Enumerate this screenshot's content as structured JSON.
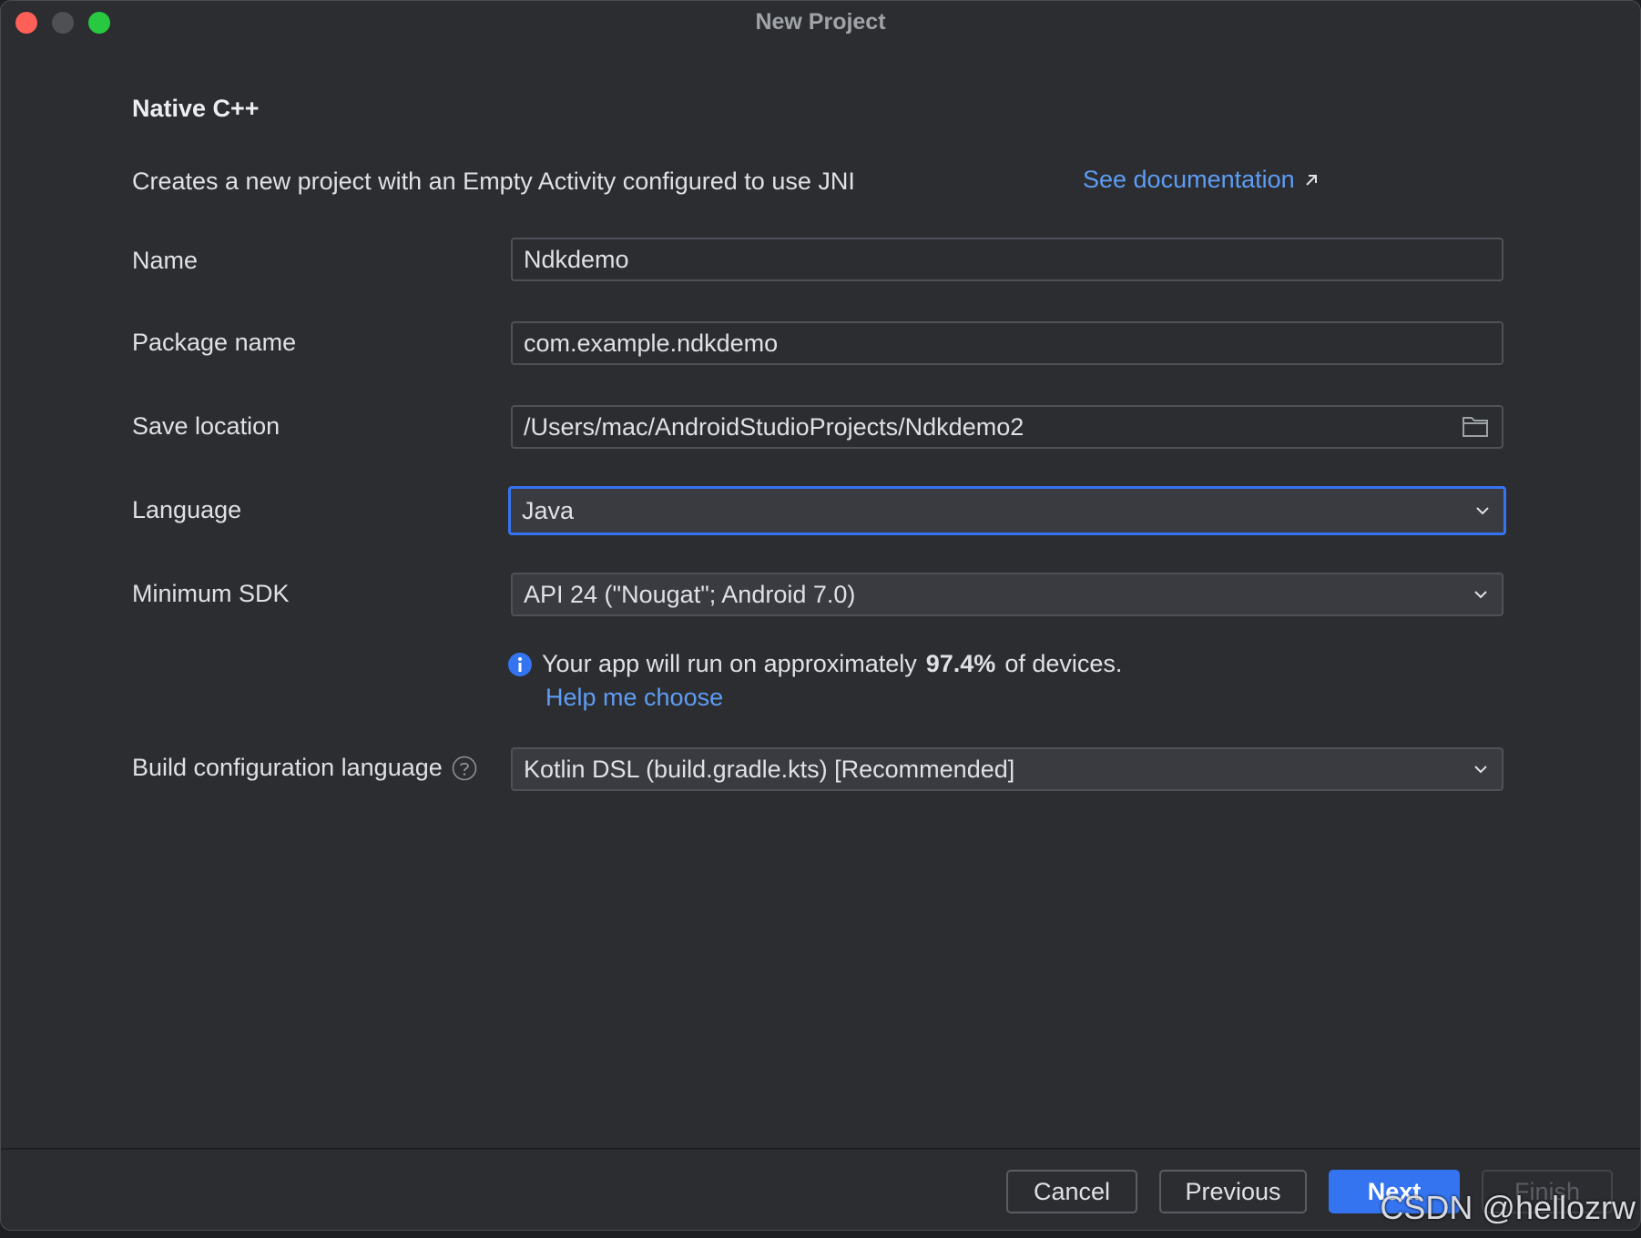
{
  "window": {
    "title": "New Project"
  },
  "template": {
    "name": "Native C++",
    "description": "Creates a new project with an Empty Activity configured to use JNI",
    "doc_link": "See documentation"
  },
  "form": {
    "name": {
      "label": "Name",
      "value": "Ndkdemo"
    },
    "package": {
      "label": "Package name",
      "value": "com.example.ndkdemo"
    },
    "location": {
      "label": "Save location",
      "value": "/Users/mac/AndroidStudioProjects/Ndkdemo2"
    },
    "language": {
      "label": "Language",
      "value": "Java"
    },
    "min_sdk": {
      "label": "Minimum SDK",
      "value": "API 24 (\"Nougat\"; Android 7.0)"
    },
    "sdk_info": {
      "prefix": "Your app will run on approximately",
      "percent": "97.4%",
      "suffix": "of devices.",
      "help_link": "Help me choose"
    },
    "build_config": {
      "label": "Build configuration language",
      "value": "Kotlin DSL (build.gradle.kts) [Recommended]"
    }
  },
  "footer": {
    "cancel": "Cancel",
    "previous": "Previous",
    "next": "Next",
    "finish": "Finish"
  },
  "watermark": "CSDN @hellozrw",
  "colors": {
    "accent": "#3574f0",
    "link": "#5e9df5",
    "background": "#2b2d30"
  }
}
